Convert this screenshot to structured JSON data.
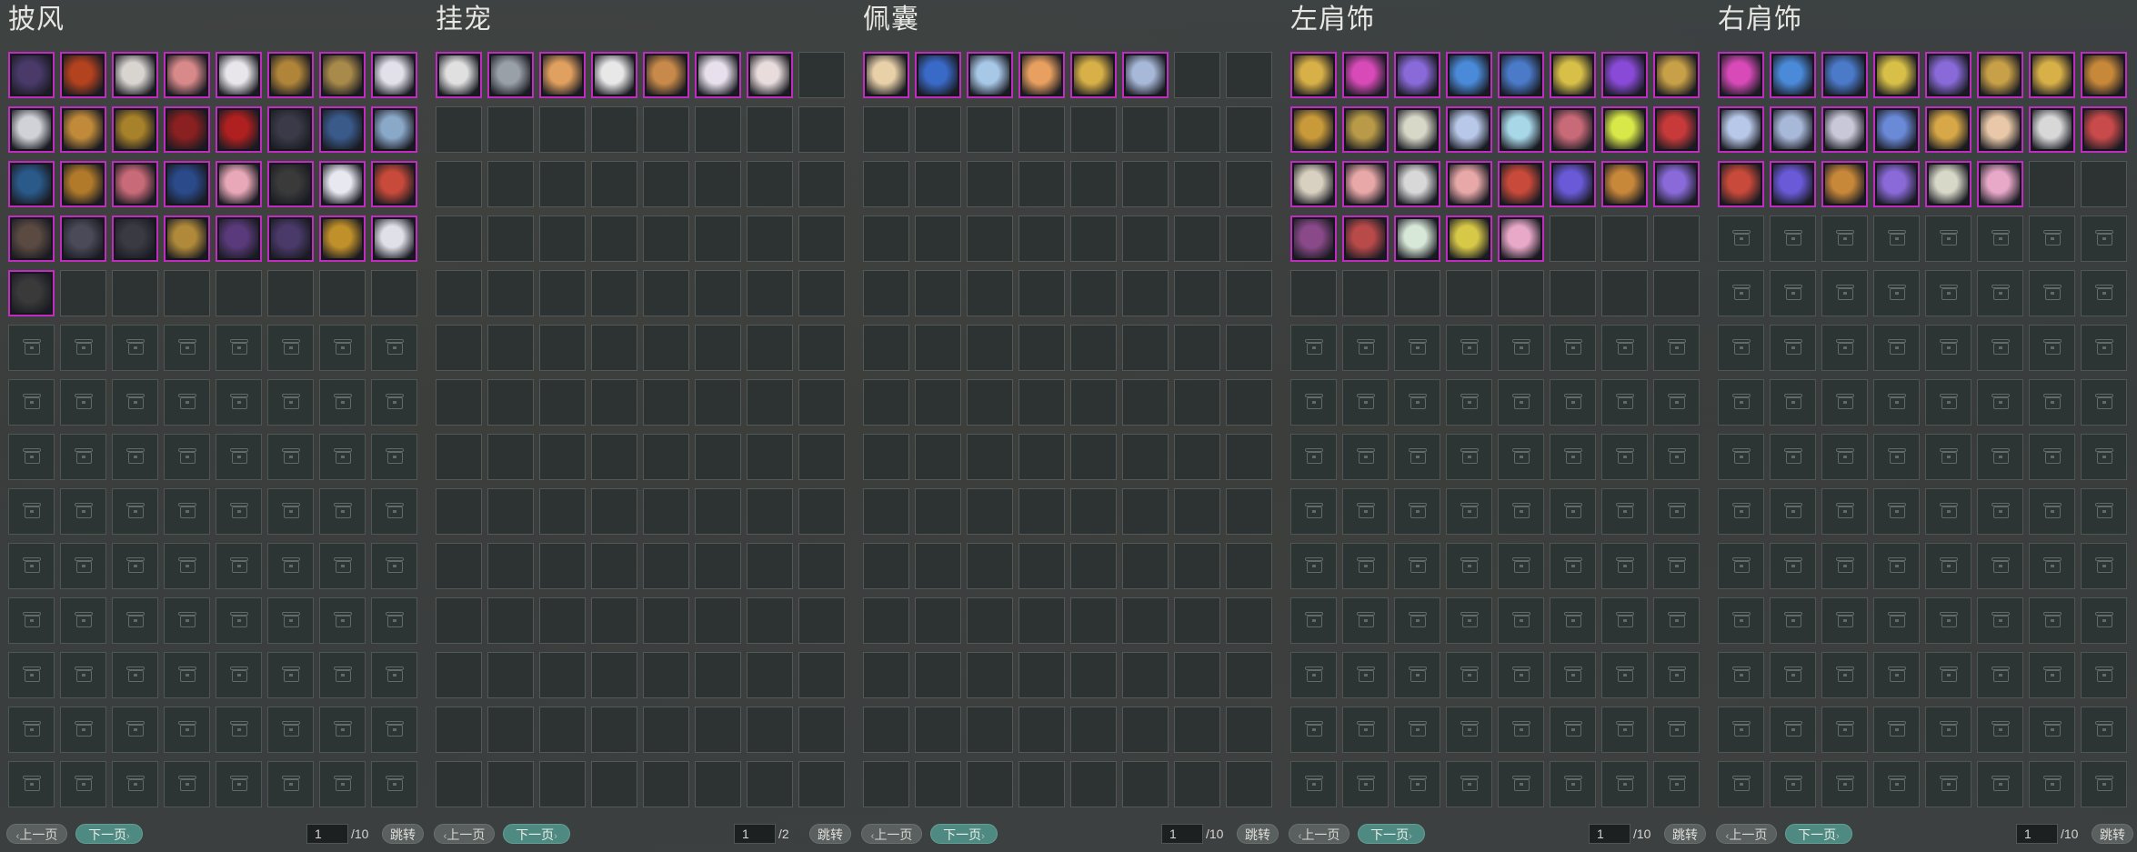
{
  "panels": [
    {
      "title": "披风",
      "filled": 33,
      "page": "1",
      "total": "/10",
      "prev": "上一页",
      "next": "下一页",
      "jump": "跳转",
      "colors": [
        "#4a3a6a",
        "#b3421f",
        "#d8d4cf",
        "#d88a8a",
        "#e8e6ea",
        "#b0853a",
        "#a88a4a",
        "#e2e0ea",
        "#d0d2d8",
        "#c08a3a",
        "#a8822a",
        "#8a2020",
        "#b02020",
        "#3a3a48",
        "#3a5a8a",
        "#8aa8c8",
        "#2a5a8a",
        "#b07a2a",
        "#c86a78",
        "#2a4a8a",
        "#e8a8b8",
        "#3a3a3a",
        "#e8e8f0",
        "#c84a3a",
        "#5a4a42",
        "#4a4a58",
        "#3a3a42",
        "#b08a3a",
        "#5a3a7a",
        "#4a3a6a",
        "#c0902a",
        "#e0e0e8",
        "#3a3a3a",
        "#3a3a3a"
      ]
    },
    {
      "title": "挂宠",
      "filled": 7,
      "page": "1",
      "total": "/2",
      "prev": "上一页",
      "next": "下一页",
      "jump": "跳转",
      "colors": [
        "#e0e0e0",
        "#9aa0a8",
        "#e0a060",
        "#e8e8e8",
        "#c88a4a",
        "#e8e0ec",
        "#e8dcdc"
      ]
    },
    {
      "title": "佩囊",
      "filled": 6,
      "page": "1",
      "total": "/10",
      "prev": "上一页",
      "next": "下一页",
      "jump": "跳转",
      "colors": [
        "#e8d0a8",
        "#3a6ac8",
        "#a8c8e8",
        "#e8a060",
        "#d8b048",
        "#a8b8d8"
      ]
    },
    {
      "title": "左肩饰",
      "filled": 29,
      "page": "1",
      "total": "/10",
      "prev": "上一页",
      "next": "下一页",
      "jump": "跳转",
      "colors": [
        "#d8b048",
        "#d84ab8",
        "#8a6ad8",
        "#4a8ad8",
        "#4a7ac8",
        "#d8c048",
        "#8a4ad8",
        "#c8a048",
        "#c89a3a",
        "#b89a48",
        "#d8d8c8",
        "#b8c8e8",
        "#a8d8e8",
        "#c86a78",
        "#d8e848",
        "#c83a3a",
        "#d8d0c0",
        "#e8a8a8",
        "#d8d8d8",
        "#e8a8a8",
        "#c84a3a",
        "#6a5ad8",
        "#c8883a",
        "#8a6ad8",
        "#8a4a8a",
        "#b84a4a",
        "#d8e8d8",
        "#d8c848",
        "#e8a8c8"
      ]
    },
    {
      "title": "右肩饰",
      "filled": 22,
      "page": "1",
      "total": "/10",
      "prev": "上一页",
      "next": "下一页",
      "jump": "跳转",
      "colors": [
        "#d84ab8",
        "#4a8ad8",
        "#4a7ac8",
        "#d8c048",
        "#8a6ad8",
        "#c8a048",
        "#d8b048",
        "#c8883a",
        "#b8c8e8",
        "#a8b8d8",
        "#c8c8d8",
        "#6a8ad8",
        "#d8a848",
        "#e8c8a8",
        "#d8d8d8",
        "#c84a4a",
        "#c84a3a",
        "#6a5ad8",
        "#c8883a",
        "#8a6ad8",
        "#d8d8c8",
        "#e8a8c8"
      ]
    }
  ]
}
